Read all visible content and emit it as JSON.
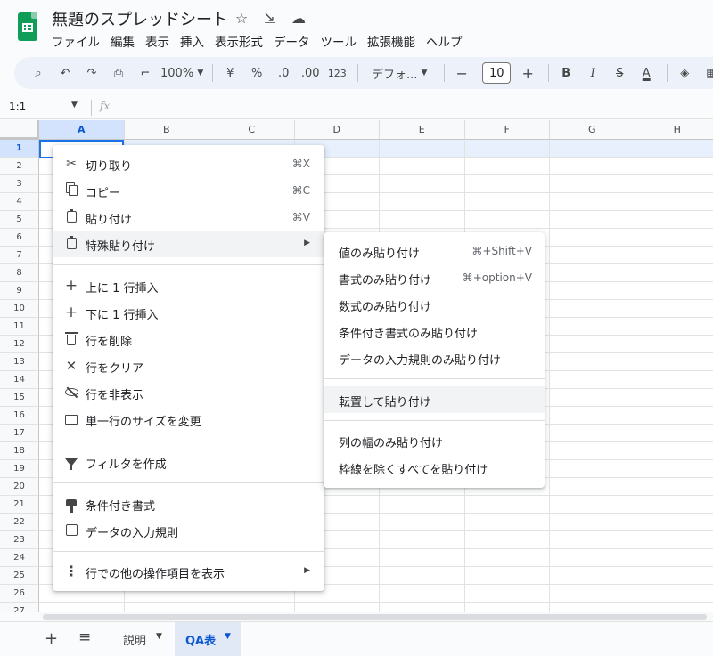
{
  "app": {
    "title": "無題のスプレッドシート",
    "menu": [
      "ファイル",
      "編集",
      "表示",
      "挿入",
      "表示形式",
      "データ",
      "ツール",
      "拡張機能",
      "ヘルプ"
    ]
  },
  "toolbar": {
    "zoom": "100%",
    "currency": "¥",
    "percent": "%",
    "dec_decrease": ".0",
    "dec_increase": ".00",
    "number_format": "123",
    "font": "デフォ...",
    "font_size": "10",
    "bold": "B",
    "italic": "I",
    "strike": "S",
    "text_color": "A"
  },
  "formula_bar": {
    "name_box": "1:1",
    "fx": "fx"
  },
  "grid": {
    "columns": [
      "A",
      "B",
      "C",
      "D",
      "E",
      "F",
      "G",
      "H"
    ],
    "rows": [
      "1",
      "2",
      "3",
      "4",
      "5",
      "6",
      "7",
      "8",
      "9",
      "10",
      "11",
      "12",
      "13",
      "14",
      "15",
      "16",
      "17",
      "18",
      "19",
      "20",
      "21",
      "22",
      "23",
      "24",
      "25",
      "26",
      "27"
    ]
  },
  "context_menu": {
    "cut": {
      "label": "切り取り",
      "shortcut": "⌘X"
    },
    "copy": {
      "label": "コピー",
      "shortcut": "⌘C"
    },
    "paste": {
      "label": "貼り付け",
      "shortcut": "⌘V"
    },
    "paste_special": {
      "label": "特殊貼り付け"
    },
    "insert_above": {
      "label": "上に 1 行挿入"
    },
    "insert_below": {
      "label": "下に 1 行挿入"
    },
    "delete_row": {
      "label": "行を削除"
    },
    "clear_row": {
      "label": "行をクリア"
    },
    "hide_row": {
      "label": "行を非表示"
    },
    "resize_row": {
      "label": "単一行のサイズを変更"
    },
    "create_filter": {
      "label": "フィルタを作成"
    },
    "conditional_format": {
      "label": "条件付き書式"
    },
    "data_validation": {
      "label": "データの入力規則"
    },
    "more_actions": {
      "label": "行での他の操作項目を表示"
    }
  },
  "paste_special_submenu": {
    "values_only": {
      "label": "値のみ貼り付け",
      "shortcut": "⌘+Shift+V"
    },
    "format_only": {
      "label": "書式のみ貼り付け",
      "shortcut": "⌘+option+V"
    },
    "formula_only": {
      "label": "数式のみ貼り付け"
    },
    "conditional_only": {
      "label": "条件付き書式のみ貼り付け"
    },
    "validation_only": {
      "label": "データの入力規則のみ貼り付け"
    },
    "transpose": {
      "label": "転置して貼り付け"
    },
    "column_width_only": {
      "label": "列の幅のみ貼り付け"
    },
    "all_except_borders": {
      "label": "枠線を除くすべてを貼り付け"
    }
  },
  "sheets": {
    "tabs": [
      {
        "label": "説明",
        "active": false
      },
      {
        "label": "QA表",
        "active": true
      }
    ]
  },
  "colors": {
    "accent": "#0b57d0",
    "selection": "#d3e3fd",
    "brand_green": "#0f9d58"
  }
}
